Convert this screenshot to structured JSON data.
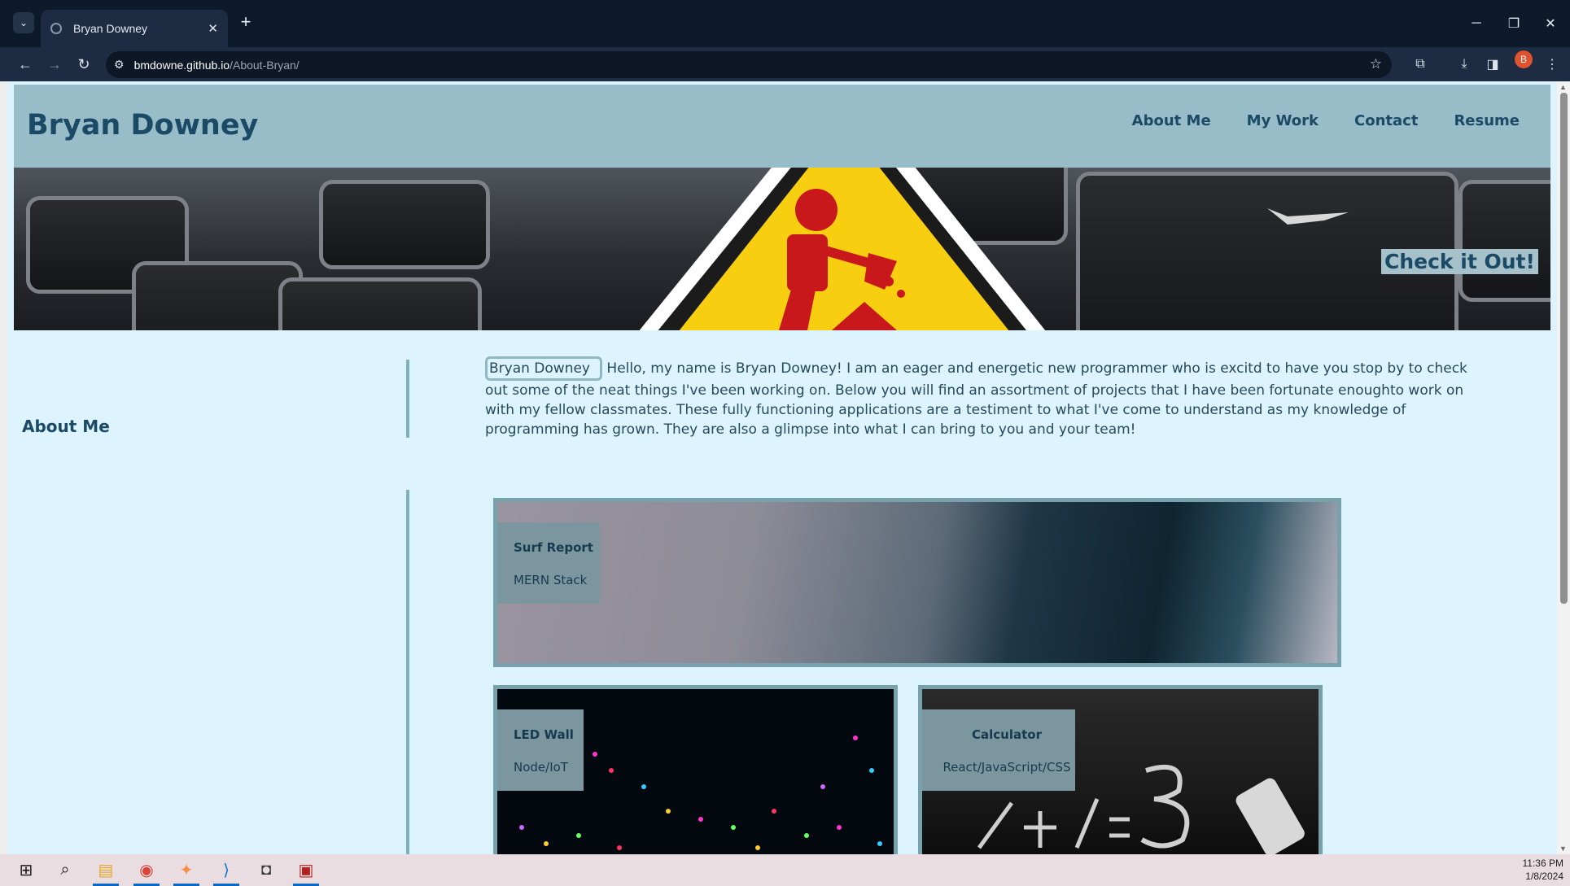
{
  "browser": {
    "tab_title": "Bryan Downey",
    "url_domain": "bmdowne.github.io",
    "url_path": "/About-Bryan/",
    "profile_initial": "B"
  },
  "site": {
    "title": "Bryan Downey",
    "nav": [
      "About Me",
      "My Work",
      "Contact",
      "Resume"
    ],
    "hero_cta": "Check it Out!",
    "about_heading": "About Me",
    "profile_img_alt": "Bryan Downey",
    "about_text": "Hello, my name is Bryan Downey! I am an eager and energetic new programmer who is excitd to have you stop by to check out some of the neat things I've been working on. Below you will find an assortment of projects that I have been fortunate enoughto work on with my fellow classmates. These fully functioning applications are a testiment to what I've come to understand as my knowledge of programming has grown. They are also a glimpse into what I can bring to you and your team!",
    "projects": [
      {
        "name": "Surf Report",
        "stack": "MERN Stack"
      },
      {
        "name": "LED Wall",
        "stack": "Node/IoT"
      },
      {
        "name": "Calculator",
        "stack": "React/JavaScript/CSS"
      }
    ]
  },
  "taskbar": {
    "time": "11:36 PM",
    "date": "1/8/2024"
  },
  "colors": {
    "page_bg": "#ddf3fd",
    "header_bg": "#99bdc8",
    "brand_text": "#1b4a66",
    "hero_sign": "#f7cf10"
  }
}
